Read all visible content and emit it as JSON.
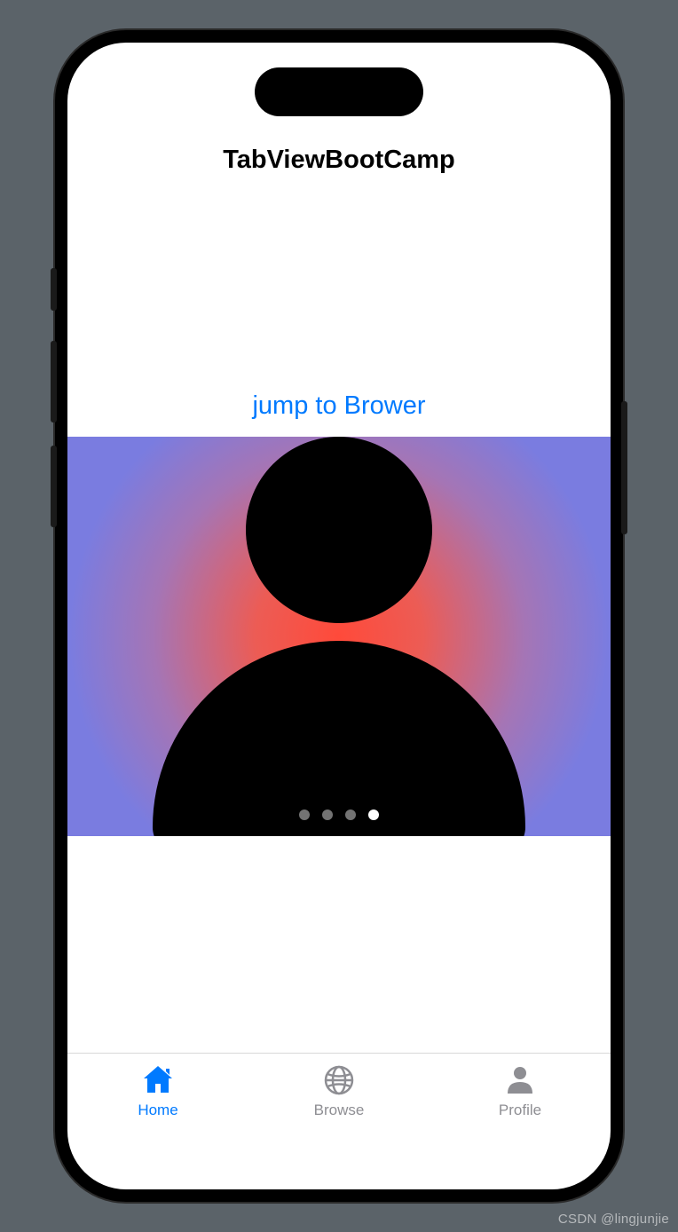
{
  "nav": {
    "title": "TabViewBootCamp"
  },
  "content": {
    "link_label": "jump to Brower",
    "carousel": {
      "total_pages": 4,
      "active_index": 3,
      "icon": "person-icon"
    }
  },
  "tabs": [
    {
      "label": "Home",
      "icon": "house-icon",
      "active": true
    },
    {
      "label": "Browse",
      "icon": "globe-icon",
      "active": false
    },
    {
      "label": "Profile",
      "icon": "person-icon",
      "active": false
    }
  ],
  "watermark": "CSDN @lingjunjie"
}
